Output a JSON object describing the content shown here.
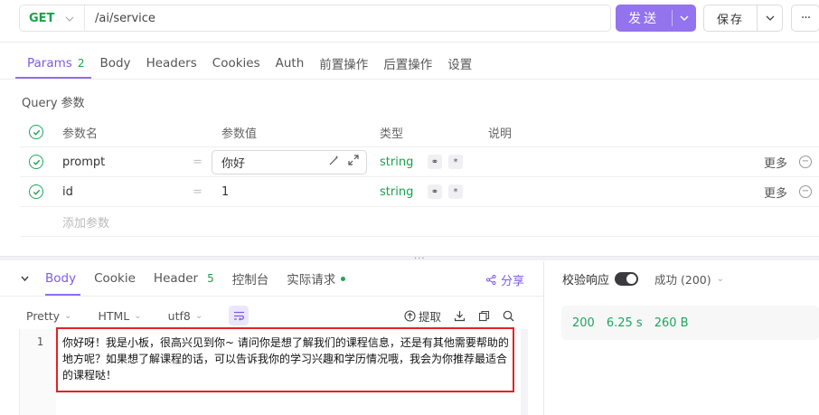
{
  "request": {
    "method": "GET",
    "url": "/ai/service",
    "send_label": "发送",
    "save_label": "保存",
    "more_label": "···"
  },
  "request_tabs": [
    {
      "label": "Params",
      "badge": "2",
      "active": true
    },
    {
      "label": "Body"
    },
    {
      "label": "Headers"
    },
    {
      "label": "Cookies"
    },
    {
      "label": "Auth"
    },
    {
      "label": "前置操作"
    },
    {
      "label": "后置操作"
    },
    {
      "label": "设置"
    }
  ],
  "query": {
    "title": "Query 参数",
    "headers": {
      "name": "参数名",
      "value": "参数值",
      "type": "类型",
      "desc": "说明"
    },
    "rows": [
      {
        "name": "prompt",
        "eq": "=",
        "value": "你好",
        "type": "string",
        "more": "更多"
      },
      {
        "name": "id",
        "eq": "=",
        "value": "1",
        "type": "string",
        "more": "更多"
      }
    ],
    "add_placeholder": "添加参数"
  },
  "splitter_dots": "···",
  "response": {
    "tabs": [
      {
        "label": "Body",
        "active": true
      },
      {
        "label": "Cookie"
      },
      {
        "label": "Header",
        "badge": "5"
      },
      {
        "label": "控制台"
      },
      {
        "label": "实际请求",
        "dot": true
      }
    ],
    "share_label": "分享",
    "format": {
      "pretty": "Pretty",
      "lang": "HTML",
      "encoding": "utf8"
    },
    "tools": {
      "extract": "提取"
    },
    "line_number": "1",
    "body_text": "你好呀！我是小板，很高兴见到你~ 请问你是想了解我们的课程信息，还是有其他需要帮助的地方呢？如果想了解课程的话，可以告诉我你的学习兴趣和学历情况哦，我会为你推荐最适合的课程哒！"
  },
  "validation": {
    "label": "校验响应",
    "status_select": "成功 (200)"
  },
  "meta": {
    "status": "200",
    "time": "6.25 s",
    "size": "260 B"
  },
  "colors": {
    "accent": "#9373ee",
    "success": "#16a34a",
    "highlight_border": "#e02424"
  }
}
